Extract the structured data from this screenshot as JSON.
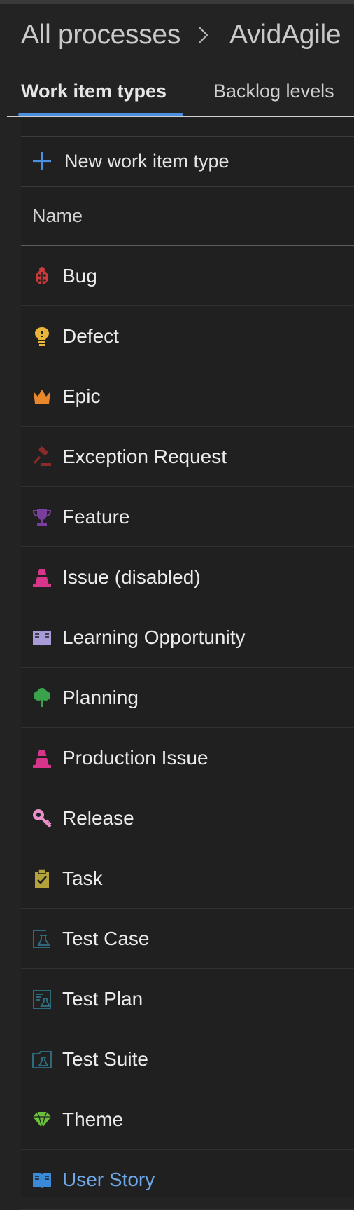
{
  "breadcrumb": {
    "root": "All processes",
    "current": "AvidAgile"
  },
  "tabs": [
    {
      "label": "Work item types",
      "active": true
    },
    {
      "label": "Backlog levels",
      "active": false
    }
  ],
  "toolbar": {
    "new_label": "New work item type"
  },
  "table": {
    "column_name": "Name"
  },
  "colors": {
    "background": "#232323",
    "accent": "#4a8fe0",
    "link": "#6ea8e8"
  },
  "items": [
    {
      "name": "Bug",
      "icon": "bug-icon",
      "color": "#cc3a3a"
    },
    {
      "name": "Defect",
      "icon": "lightbulb-icon",
      "color": "#e6b53a"
    },
    {
      "name": "Epic",
      "icon": "crown-icon",
      "color": "#e8872c"
    },
    {
      "name": "Exception Request",
      "icon": "gavel-icon",
      "color": "#8a2a2a"
    },
    {
      "name": "Feature",
      "icon": "trophy-icon",
      "color": "#7a3f9e"
    },
    {
      "name": "Issue (disabled)",
      "icon": "cone-icon",
      "color": "#d8358a"
    },
    {
      "name": "Learning Opportunity",
      "icon": "book-icon",
      "color": "#a99ad8"
    },
    {
      "name": "Planning",
      "icon": "tree-icon",
      "color": "#3aa24a"
    },
    {
      "name": "Production Issue",
      "icon": "cone-icon",
      "color": "#d8358a"
    },
    {
      "name": "Release",
      "icon": "key-icon",
      "color": "#e88fc8"
    },
    {
      "name": "Task",
      "icon": "clipboard-check-icon",
      "color": "#b3a23a"
    },
    {
      "name": "Test Case",
      "icon": "test-case-icon",
      "color": "#2e6a7c"
    },
    {
      "name": "Test Plan",
      "icon": "test-plan-icon",
      "color": "#2e6a7c"
    },
    {
      "name": "Test Suite",
      "icon": "test-suite-icon",
      "color": "#2e6a7c"
    },
    {
      "name": "Theme",
      "icon": "gem-icon",
      "color": "#6ac03a"
    },
    {
      "name": "User Story",
      "icon": "book-icon",
      "color": "#3a8ad8"
    }
  ]
}
